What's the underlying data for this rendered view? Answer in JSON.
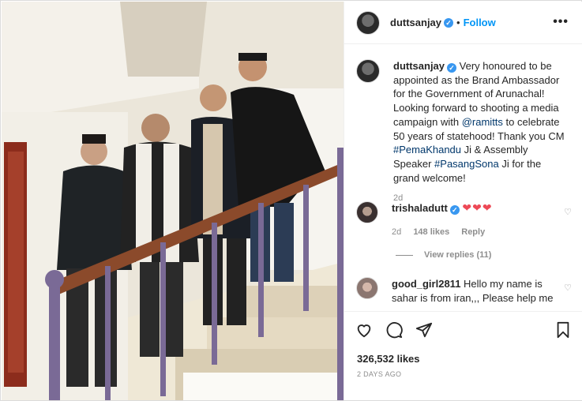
{
  "post": {
    "username": "duttsanjay",
    "follow_label": "Follow",
    "separator": "•",
    "more_label": "•••"
  },
  "caption": {
    "username": "duttsanjay",
    "text_1": "Very honoured to be appointed as the Brand Ambassador for the Government of Arunachal! Looking forward to shooting a media campaign with ",
    "mention": "@ramitts",
    "text_2": " to celebrate 50 years of statehood! Thank you CM ",
    "hashtag_1": "#PemaKhandu",
    "text_3": " Ji & Assembly Speaker ",
    "hashtag_2": "#PasangSona",
    "text_4": " Ji for the grand welcome!",
    "time": "2d"
  },
  "comments": [
    {
      "username": "trishaladutt",
      "text": "❤❤❤",
      "time": "2d",
      "likes": "148 likes",
      "reply_label": "Reply",
      "view_replies": "View replies (11)"
    },
    {
      "username": "good_girl2811",
      "text": "Hello my name is sahar is from iran,,, Please help me"
    }
  ],
  "stats": {
    "likes": "326,532 likes",
    "date": "2 DAYS AGO"
  },
  "icons": {
    "like": "heart-icon",
    "comment": "comment-icon",
    "share": "share-icon",
    "save": "bookmark-icon",
    "verified": "verified-badge-icon"
  },
  "colors": {
    "link": "#0095f6",
    "hashtag": "#00376b",
    "verified": "#3897f0",
    "heart": "#ed4956",
    "secondary_text": "#8e8e8e"
  }
}
